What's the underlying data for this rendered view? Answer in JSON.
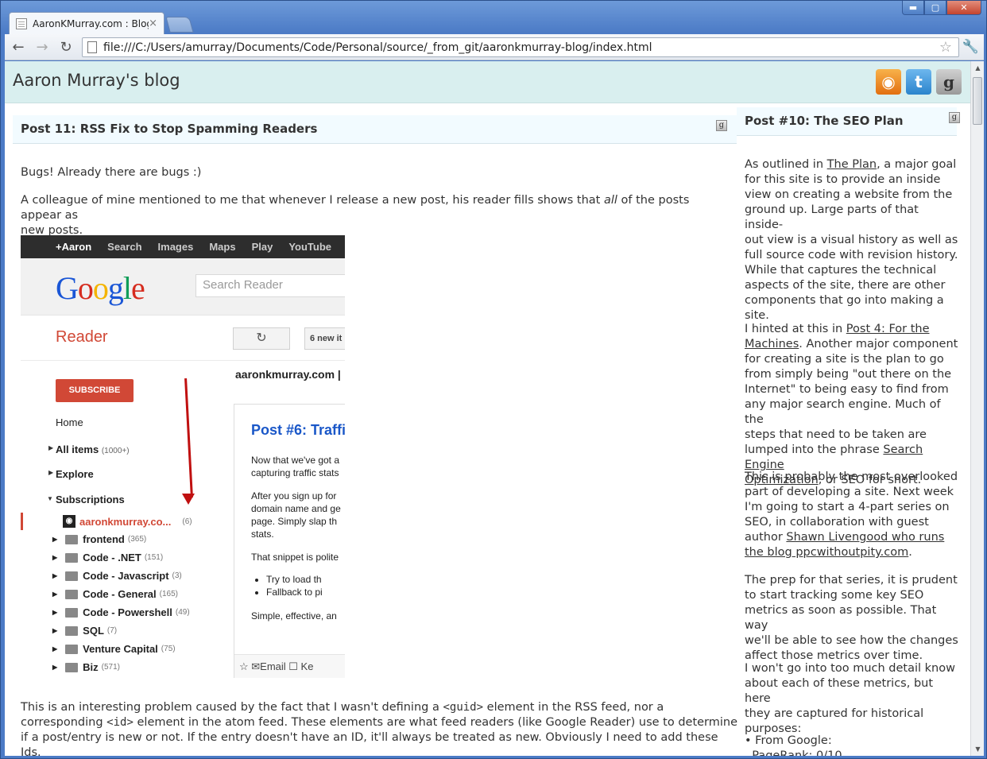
{
  "browser": {
    "tab_title": "AaronKMurray.com : Blog",
    "tab_close": "×",
    "url": "file:///C:/Users/amurray/Documents/Code/Personal/source/_from_git/aaronkmurray-blog/index.html",
    "controls": {
      "minimize": "▬",
      "maximize": "▢",
      "close": "✕"
    },
    "nav": {
      "back": "←",
      "forward": "→",
      "reload": "↻",
      "star": "☆",
      "wrench": "🔧"
    }
  },
  "site": {
    "title": "Aaron Murray's blog",
    "social": [
      {
        "name": "rss-icon",
        "glyph": "◉"
      },
      {
        "name": "twitter-icon",
        "glyph": "t"
      },
      {
        "name": "google-icon",
        "glyph": "g"
      }
    ]
  },
  "post": {
    "title": "Post 11: RSS Fix to Stop Spamming Readers",
    "badge": "g",
    "p1": "Bugs! Already there are bugs :)",
    "p2a": "A colleague of mine mentioned to me that whenever I release a new post, his reader fills shows that ",
    "p2em": "all",
    "p2b": " of the posts appear as",
    "p2c": "new posts.",
    "p3a": "This is an interesting problem caused by the fact that I wasn't defining a ",
    "p3code1": "<guid>",
    "p3b": " element in the RSS feed, nor a",
    "p3c": "corresponding ",
    "p3code2": "<id>",
    "p3d": " element in the atom feed. These elements are what feed readers (like Google Reader) use to determine",
    "p3e": "if a post/entry is new or not. If the entry doesn't have an ID, it'll always be treated as new. Obviously I need to add these Ids."
  },
  "reader_screenshot": {
    "gbar": [
      "+Aaron",
      "Search",
      "Images",
      "Maps",
      "Play",
      "YouTube"
    ],
    "logo": "Google",
    "search_placeholder": "Search Reader",
    "title": "Reader",
    "refresh": "↻",
    "new_items": "6 new it",
    "subscribe": "SUBSCRIBE",
    "home": "Home",
    "all_items": "All items",
    "all_items_count": "(1000+)",
    "explore": "Explore",
    "subscriptions": "Subscriptions",
    "feed": "aaronkmurray.co...",
    "feed_count": "(6)",
    "folders": [
      {
        "name": "frontend",
        "count": "(365)"
      },
      {
        "name": "Code - .NET",
        "count": "(151)"
      },
      {
        "name": "Code - Javascript",
        "count": "(3)"
      },
      {
        "name": "Code - General",
        "count": "(165)"
      },
      {
        "name": "Code - Powershell",
        "count": "(49)"
      },
      {
        "name": "SQL",
        "count": "(7)"
      },
      {
        "name": "Venture Capital",
        "count": "(75)"
      },
      {
        "name": "Biz",
        "count": "(571)"
      }
    ],
    "entry_header": "aaronkmurray.com |",
    "entry_title": "Post #6: Traffi",
    "entry_lines": [
      "Now that we've got a",
      "capturing traffic stats",
      "After you sign up for",
      "domain name and ge",
      "page. Simply slap th",
      "stats.",
      "That snippet is polite"
    ],
    "entry_bullets": [
      "Try to load th",
      "Fallback to pi"
    ],
    "entry_last": "Simple, effective, an",
    "entry_foot": "☆   ✉Email   ☐ Ke"
  },
  "sidebar": {
    "title": "Post #10: The SEO Plan",
    "badge": "g",
    "p1_lines": [
      "As outlined in ",
      "The Plan",
      ", a major goal",
      "for this site is to provide an inside",
      "view on creating a website from the",
      "ground up. Large parts of that inside-",
      "out view is a visual history as well as",
      "full source code with revision history.",
      "While that captures the technical",
      "aspects of the site, there are other",
      "components that go into making a",
      "site."
    ],
    "p2_lines": [
      "I hinted at this in ",
      "Post 4: For the",
      "Machines",
      ". Another major component",
      "for creating a site is the plan to go",
      "from simply being \"out there on the",
      "Internet\" to being easy to find from",
      "any major search engine. Much of the",
      "steps that need to be taken are",
      "lumped into the phrase ",
      "Search Engine",
      "Optimization",
      ", or SEO for short."
    ],
    "p3_lines": [
      "This is probably the most overlooked",
      "part of developing a site. Next week",
      "I'm going to start a 4-part series on",
      "SEO, in collaboration with guest",
      "author ",
      "Shawn Livengood who runs",
      "the blog ppcwithoutpity.com",
      "."
    ],
    "p4_lines": [
      "The prep for that series, it is prudent",
      "to start tracking some key SEO",
      "metrics as soon as possible. That way",
      "we'll be able to see how the changes",
      "affect those metrics over time."
    ],
    "p5_lines": [
      "I won't go into too much detail know",
      "about each of these metrics, but here",
      "they are captured for historical",
      "purposes:"
    ],
    "list_item": "From Google:",
    "list_sub": "PageRank: 0/10"
  }
}
